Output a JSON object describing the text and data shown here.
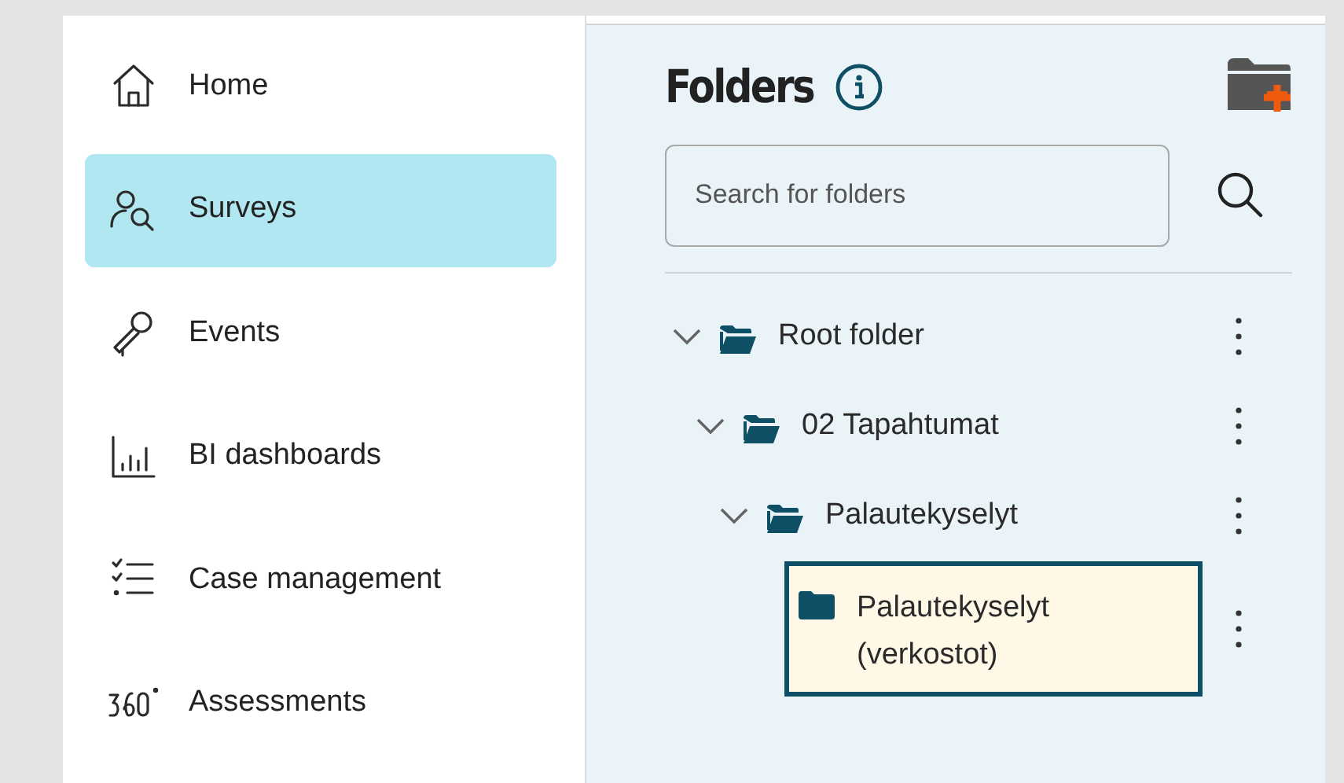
{
  "sidebar": {
    "items": [
      {
        "label": "Home",
        "selected": false
      },
      {
        "label": "Surveys",
        "selected": true
      },
      {
        "label": "Events",
        "selected": false
      },
      {
        "label": "BI dashboards",
        "selected": false
      },
      {
        "label": "Case management",
        "selected": false
      },
      {
        "label": "Assessments",
        "selected": false
      }
    ]
  },
  "folders": {
    "title": "Folders",
    "search": {
      "placeholder": "Search for folders"
    },
    "tree": [
      {
        "label": "Root folder",
        "expanded": true,
        "selected": false,
        "children": [
          {
            "label": "02 Tapahtumat",
            "expanded": true,
            "selected": false,
            "children": [
              {
                "label": "Palautekyselyt",
                "expanded": true,
                "selected": false,
                "children": [
                  {
                    "label": "Palautekyselyt (verkostot)",
                    "selected": true
                  }
                ]
              }
            ]
          }
        ]
      }
    ]
  }
}
